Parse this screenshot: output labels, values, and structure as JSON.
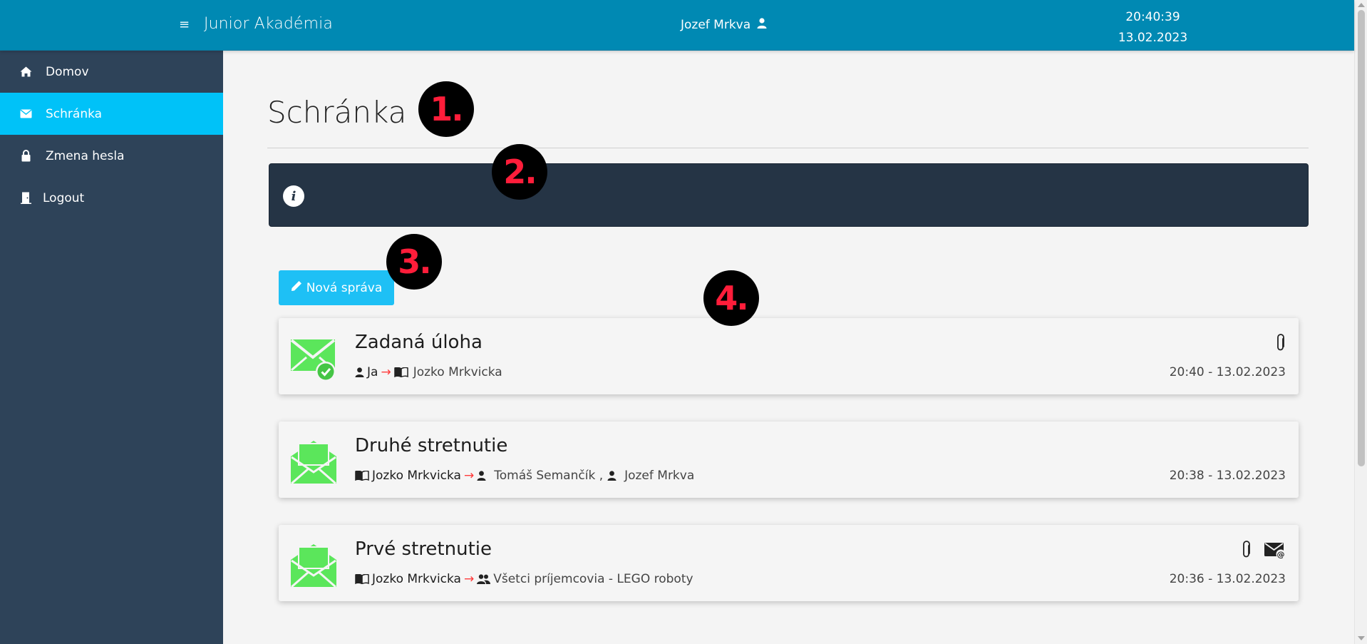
{
  "header": {
    "brand": "Junior Akadémia",
    "user_name": "Jozef Mrkva",
    "time": "20:40:39",
    "date": "13.02.2023"
  },
  "sidebar": {
    "items": [
      {
        "label": "Domov",
        "icon": "home-icon"
      },
      {
        "label": "Schránka",
        "icon": "envelope-icon",
        "active": true
      },
      {
        "label": "Zmena hesla",
        "icon": "lock-icon"
      },
      {
        "label": "Logout",
        "icon": "door-icon"
      }
    ]
  },
  "page": {
    "title": "Schránka",
    "info_text": "",
    "new_message_label": "Nová správa"
  },
  "messages": [
    {
      "subject": "Zadaná úloha",
      "sender": "Ja",
      "recipient": "Jozko Mrkvicka",
      "time": "20:40 - 13.02.2023",
      "attachment": true,
      "email_copy": false,
      "state": "sent"
    },
    {
      "subject": "Druhé stretnutie",
      "sender": "Jozko Mrkvicka",
      "recipient_1": "Tomáš Semančík ,",
      "recipient_2": "Jozef Mrkva",
      "time": "20:38 - 13.02.2023",
      "attachment": false,
      "email_copy": false,
      "state": "read"
    },
    {
      "subject": "Prvé stretnutie",
      "sender": "Jozko Mrkvicka",
      "recipient": "Všetci príjemcovia - LEGO roboty",
      "time": "20:36 - 13.02.2023",
      "attachment": true,
      "email_copy": true,
      "state": "read"
    }
  ],
  "annotations": [
    "1.",
    "2.",
    "3.",
    "4."
  ],
  "colors": {
    "header": "#0089b3",
    "sidebar": "#2e4359",
    "sidebar_active": "#00c2f8",
    "button": "#1ec0f5",
    "info_box": "#253445",
    "envelope_green": "#5be65b",
    "arrow_red": "#ff3b3b",
    "badge_text": "#ff1d3a"
  }
}
